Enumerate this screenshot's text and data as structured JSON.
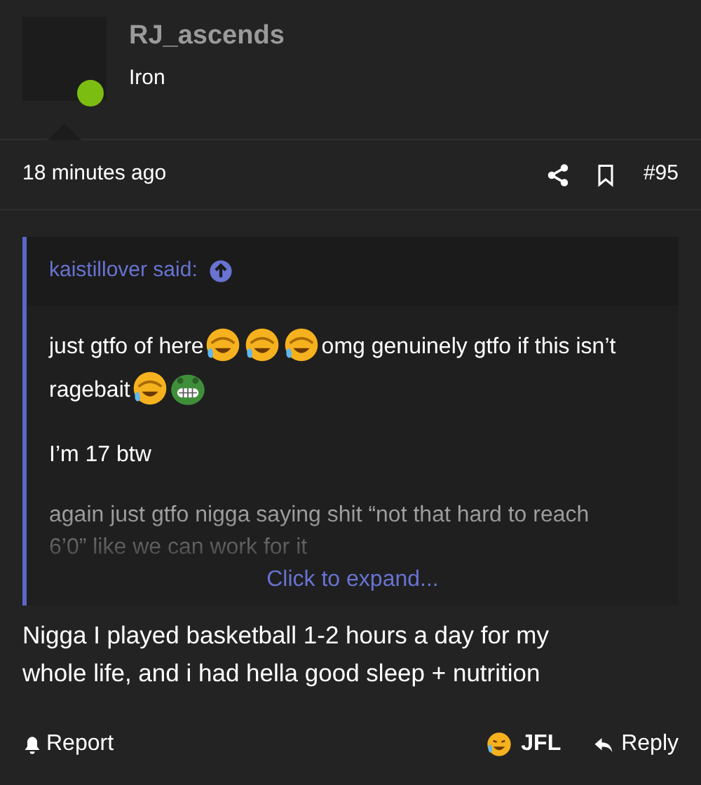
{
  "author": {
    "username": "RJ_ascends",
    "rank": "Iron",
    "online": true
  },
  "meta": {
    "time": "18 minutes ago",
    "post_number": "#95"
  },
  "quote": {
    "attribution": "kaistillover said:",
    "paragraphs": [
      {
        "faded": false,
        "segments": [
          {
            "kind": "text",
            "text": "just gtfo of here"
          },
          {
            "kind": "laugh-emoji"
          },
          {
            "kind": "laugh-emoji"
          },
          {
            "kind": "laugh-emoji"
          },
          {
            "kind": "text",
            "text": "omg genuinely gtfo if this isn’t"
          },
          {
            "kind": "text",
            "text": "ragebait"
          },
          {
            "kind": "laugh-emoji"
          },
          {
            "kind": "frog-emoji"
          }
        ]
      },
      {
        "faded": false,
        "segments": [
          {
            "kind": "text",
            "text": "I’m 17 btw"
          }
        ]
      },
      {
        "faded": true,
        "segments": [
          {
            "kind": "text",
            "text": "again just gtfo nigga saying shit “not that hard to reach"
          },
          {
            "kind": "text",
            "text": "6’0” like we can work for it"
          }
        ]
      }
    ],
    "expand": "Click to expand..."
  },
  "body": "Nigga I played basketball 1-2 hours a day for my whole life, and i had hella good sleep + nutrition",
  "actions": {
    "report": "Report",
    "reaction": "JFL",
    "reply": "Reply"
  }
}
